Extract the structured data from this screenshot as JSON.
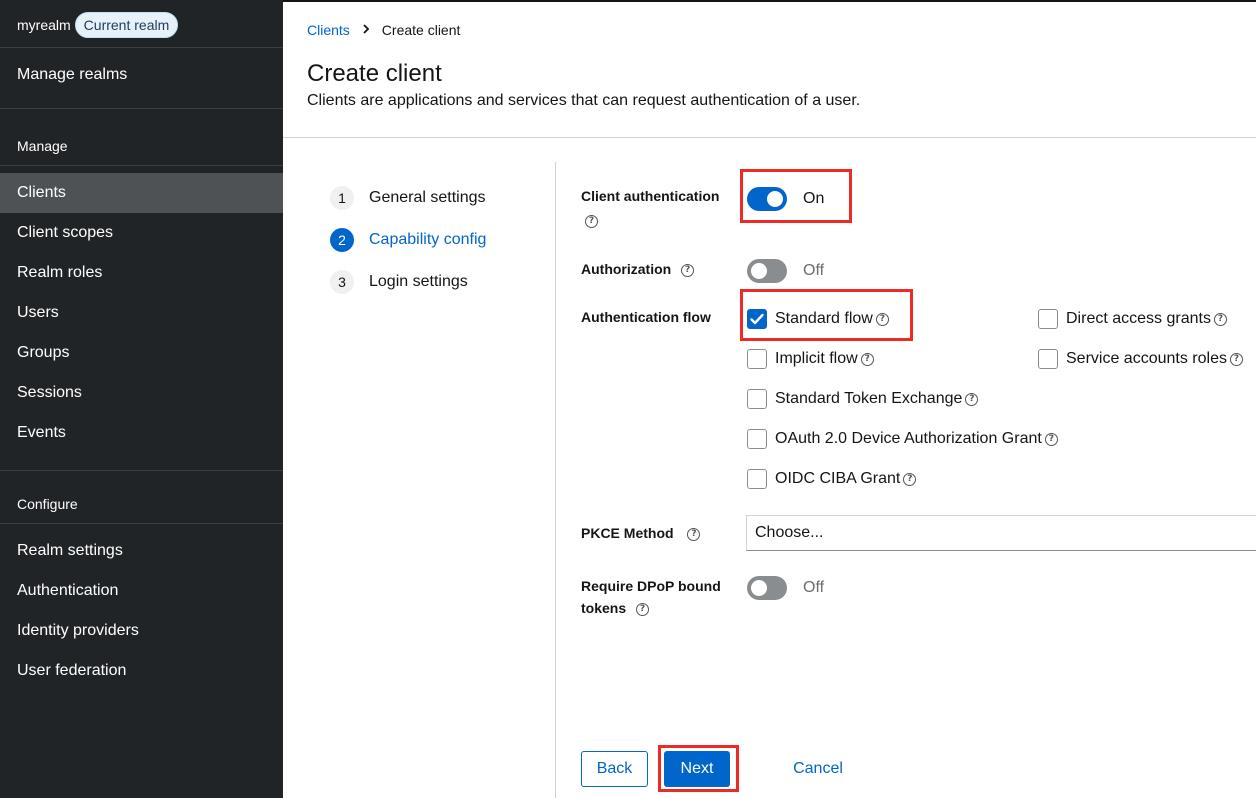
{
  "sidebar": {
    "realm_name": "myrealm",
    "realm_badge": "Current realm",
    "manage_realms": "Manage realms",
    "manage_section": "Manage",
    "manage_items": [
      "Clients",
      "Client scopes",
      "Realm roles",
      "Users",
      "Groups",
      "Sessions",
      "Events"
    ],
    "configure_section": "Configure",
    "configure_items": [
      "Realm settings",
      "Authentication",
      "Identity providers",
      "User federation"
    ]
  },
  "breadcrumb": {
    "parent": "Clients",
    "current": "Create client"
  },
  "page": {
    "title": "Create client",
    "description": "Clients are applications and services that can request authentication of a user."
  },
  "wizard": {
    "steps": [
      {
        "num": "1",
        "label": "General settings"
      },
      {
        "num": "2",
        "label": "Capability config"
      },
      {
        "num": "3",
        "label": "Login settings"
      }
    ]
  },
  "form": {
    "client_auth": {
      "label": "Client authentication",
      "state": "On"
    },
    "authorization": {
      "label": "Authorization",
      "state": "Off"
    },
    "auth_flow": {
      "label": "Authentication flow",
      "options": [
        "Standard flow",
        "Direct access grants",
        "Implicit flow",
        "Service accounts roles",
        "Standard Token Exchange",
        "OAuth 2.0 Device Authorization Grant",
        "OIDC CIBA Grant"
      ]
    },
    "pkce": {
      "label": "PKCE Method",
      "placeholder": "Choose..."
    },
    "dpop": {
      "label_line1": "Require DPoP bound",
      "label_line2": "tokens",
      "state": "Off"
    }
  },
  "buttons": {
    "back": "Back",
    "next": "Next",
    "cancel": "Cancel"
  },
  "colors": {
    "accent": "#0066cc",
    "sidebar_bg": "#212427",
    "highlight": "#ee2a24"
  },
  "icons": {
    "help": "help-circle-icon",
    "check": "check-icon",
    "breadcrumb_separator": "chevron-right-icon"
  }
}
